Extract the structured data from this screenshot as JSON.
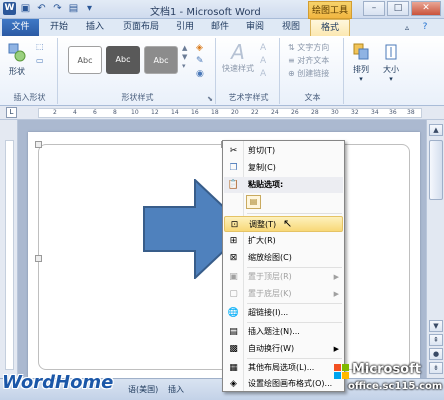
{
  "titlebar": {
    "title": "文档1 - Microsoft Word",
    "context_title": "绘图工具",
    "qat_icons": [
      "word-icon",
      "save-icon",
      "undo-icon",
      "redo-icon",
      "open-icon",
      "dropdown-icon"
    ]
  },
  "tabs": [
    {
      "label": "文件"
    },
    {
      "label": "开始"
    },
    {
      "label": "插入"
    },
    {
      "label": "页面布局"
    },
    {
      "label": "引用"
    },
    {
      "label": "邮件"
    },
    {
      "label": "审阅"
    },
    {
      "label": "视图"
    },
    {
      "label": "格式"
    }
  ],
  "ribbon": {
    "insert_shapes": {
      "button_label": "形状",
      "group_label": "插入形状"
    },
    "shape_styles": {
      "swatches": [
        "Abc",
        "Abc",
        "Abc"
      ],
      "group_label": "形状样式"
    },
    "wordart": {
      "button_label": "快速样式",
      "group_label": "艺术字样式"
    },
    "text": {
      "items": [
        "文字方向",
        "对齐文本",
        "创建链接"
      ],
      "group_label": "文本"
    },
    "arrange": {
      "button_label": "排列"
    },
    "size": {
      "button_label": "大小"
    }
  },
  "ruler": {
    "numbers": [
      "2",
      "4",
      "6",
      "8",
      "10",
      "12",
      "14",
      "16",
      "18",
      "20",
      "22",
      "24",
      "26",
      "28",
      "30",
      "32",
      "34",
      "36",
      "38"
    ]
  },
  "context_menu": {
    "items": [
      {
        "label": "剪切(T)",
        "icon": "scissors-icon",
        "state": "normal"
      },
      {
        "label": "复制(C)",
        "icon": "copy-icon",
        "state": "normal"
      },
      {
        "label": "粘贴选项:",
        "icon": "paste-icon",
        "state": "header"
      },
      {
        "label": "调整(T)",
        "icon": "adjust-icon",
        "state": "highlighted"
      },
      {
        "label": "扩大(R)",
        "icon": "expand-icon",
        "state": "normal"
      },
      {
        "label": "缩放绘图(C)",
        "icon": "scale-icon",
        "state": "normal"
      },
      {
        "label": "置于顶层(R)",
        "icon": "bring-front-icon",
        "state": "disabled"
      },
      {
        "label": "置于底层(K)",
        "icon": "send-back-icon",
        "state": "disabled"
      },
      {
        "label": "超链接(I)...",
        "icon": "hyperlink-icon",
        "state": "normal"
      },
      {
        "label": "插入题注(N)...",
        "icon": "caption-icon",
        "state": "normal"
      },
      {
        "label": "自动换行(W)",
        "icon": "wrap-icon",
        "state": "normal"
      },
      {
        "label": "其他布局选项(L)...",
        "icon": "layout-icon",
        "state": "normal"
      },
      {
        "label": "设置绘图画布格式(O)...",
        "icon": "format-icon",
        "state": "normal"
      }
    ]
  },
  "statusbar": {
    "language": "语(美国)",
    "mode": "插入"
  },
  "watermarks": {
    "left": "WordHome",
    "ms_brand": "Microsoft",
    "ms_site": "office.sc115.com"
  },
  "colors": {
    "arrow_fill": "#4f81bd",
    "arrow_stroke": "#385d8a",
    "accent": "#2b579a",
    "highlight": "#f8d878"
  }
}
